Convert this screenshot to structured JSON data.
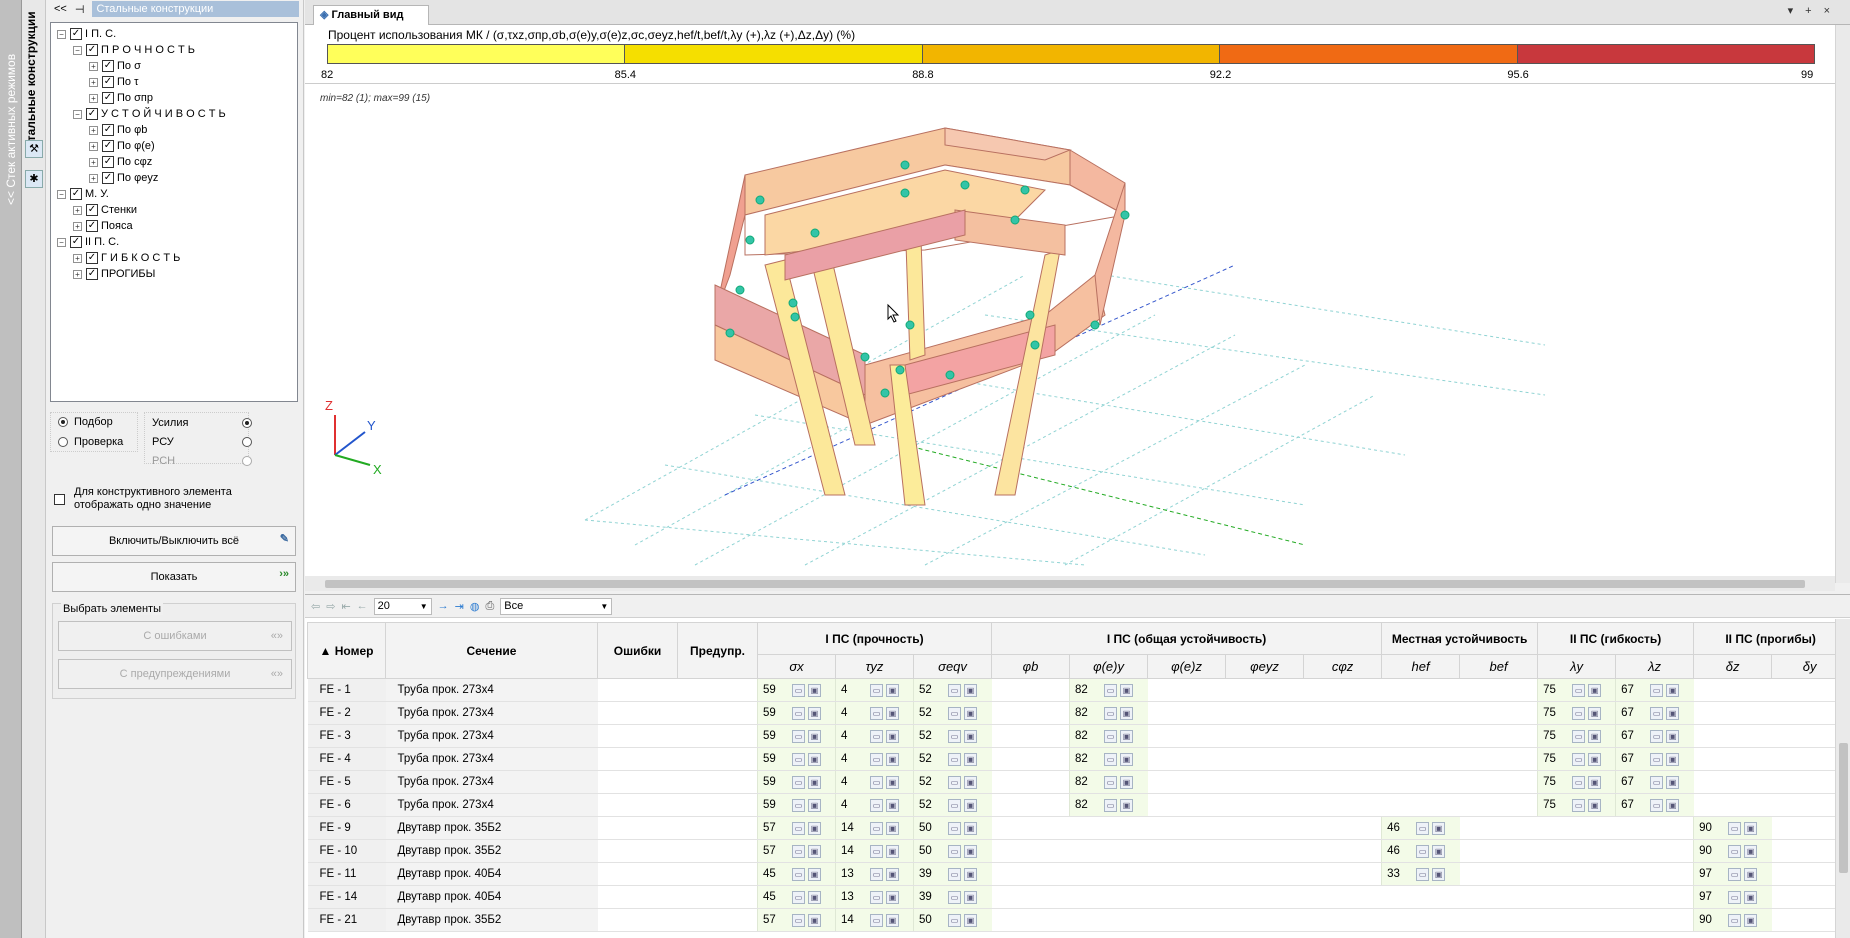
{
  "side": {
    "stack_label": "<< Стек активных режимов",
    "mode_label": "Стальные конструкции"
  },
  "left": {
    "title": "Стальные конструкции",
    "tree": [
      {
        "text": "I  П. С.",
        "level": 0,
        "toggle": "−"
      },
      {
        "text": "П Р О Ч Н О С Т Ь",
        "level": 1,
        "toggle": "−"
      },
      {
        "text": "По σ",
        "level": 2,
        "toggle": "+"
      },
      {
        "text": "По τ",
        "level": 2,
        "toggle": "+"
      },
      {
        "text": "По σпр",
        "level": 2,
        "toggle": "+"
      },
      {
        "text": "У С Т О Й Ч И В О С Т Ь",
        "level": 1,
        "toggle": "−"
      },
      {
        "text": "По φb",
        "level": 2,
        "toggle": "+"
      },
      {
        "text": "По φ(e)",
        "level": 2,
        "toggle": "+"
      },
      {
        "text": "По cφz",
        "level": 2,
        "toggle": "+"
      },
      {
        "text": "По φeyz",
        "level": 2,
        "toggle": "+"
      },
      {
        "text": "М. У.",
        "level": 0,
        "toggle": "−"
      },
      {
        "text": "Стенки",
        "level": 1,
        "toggle": "+"
      },
      {
        "text": "Пояса",
        "level": 1,
        "toggle": "+"
      },
      {
        "text": "II  П. С.",
        "level": 0,
        "toggle": "−"
      },
      {
        "text": "Г И Б К О С Т Ь",
        "level": 1,
        "toggle": "+"
      },
      {
        "text": "ПРОГИБЫ",
        "level": 1,
        "toggle": "+"
      }
    ],
    "mode_podbor": "Подбор",
    "mode_proverka": "Проверка",
    "forces": "Усилия",
    "rsu": "РСУ",
    "rsn": "РСН",
    "one_value": "Для конструктивного элемента отображать одно значение",
    "toggle_all": "Включить/Выключить всё",
    "show": "Показать",
    "select_group": "Выбрать элементы",
    "with_errors": "С ошибками",
    "with_warnings": "С предупреждениями"
  },
  "main": {
    "tab": "Главный вид",
    "legend_title": "Процент использования МК / (σ,τxz,σпр,σb,σ(e)y,σ(e)z,σc,σeyz,hef/t,bef/t,λy (+),λz (+),Δz,Δy) (%)",
    "legend_values": [
      "82",
      "85.4",
      "88.8",
      "92.2",
      "95.6",
      "99"
    ],
    "legend_colors": [
      "#ffff5a",
      "#f5df00",
      "#f2b500",
      "#f06a14",
      "#c8383d"
    ],
    "minmax": "min=82 (1); max=99 (15)",
    "axes": {
      "z": "Z",
      "y": "Y",
      "x": "X"
    }
  },
  "grid": {
    "page_size": "20",
    "filter": "Все",
    "headers": {
      "number": "Номер",
      "section": "Сечение",
      "errors": "Ошибки",
      "warnings": "Предупр.",
      "g1": "I ПС (прочность)",
      "g2": "I ПС (общая устойчивость)",
      "g3": "Местная устойчивость",
      "g4": "II ПС (гибкость)",
      "g5": "II ПС (прогибы)"
    },
    "subheaders": [
      "σx",
      "τyz",
      "σeqv",
      "φb",
      "φ(e)y",
      "φ(e)z",
      "φeyz",
      "cφz",
      "hef",
      "bef",
      "λy",
      "λz",
      "δz",
      "δy"
    ],
    "rows": [
      {
        "id": "FE - 1",
        "sec": "Труба прок. 273x4",
        "c": [
          "59",
          "4",
          "52",
          "",
          "82",
          "",
          "",
          "",
          "",
          "",
          "75",
          "67",
          "",
          ""
        ]
      },
      {
        "id": "FE - 2",
        "sec": "Труба прок. 273x4",
        "c": [
          "59",
          "4",
          "52",
          "",
          "82",
          "",
          "",
          "",
          "",
          "",
          "75",
          "67",
          "",
          ""
        ]
      },
      {
        "id": "FE - 3",
        "sec": "Труба прок. 273x4",
        "c": [
          "59",
          "4",
          "52",
          "",
          "82",
          "",
          "",
          "",
          "",
          "",
          "75",
          "67",
          "",
          ""
        ]
      },
      {
        "id": "FE - 4",
        "sec": "Труба прок. 273x4",
        "c": [
          "59",
          "4",
          "52",
          "",
          "82",
          "",
          "",
          "",
          "",
          "",
          "75",
          "67",
          "",
          ""
        ]
      },
      {
        "id": "FE - 5",
        "sec": "Труба прок. 273x4",
        "c": [
          "59",
          "4",
          "52",
          "",
          "82",
          "",
          "",
          "",
          "",
          "",
          "75",
          "67",
          "",
          ""
        ]
      },
      {
        "id": "FE - 6",
        "sec": "Труба прок. 273x4",
        "c": [
          "59",
          "4",
          "52",
          "",
          "82",
          "",
          "",
          "",
          "",
          "",
          "75",
          "67",
          "",
          ""
        ]
      },
      {
        "id": "FE - 9",
        "sec": "Двутавр прок. 35Б2",
        "c": [
          "57",
          "14",
          "50",
          "",
          "",
          "",
          "",
          "",
          "46",
          "",
          "",
          "",
          "90",
          ""
        ]
      },
      {
        "id": "FE - 10",
        "sec": "Двутавр прок. 35Б2",
        "c": [
          "57",
          "14",
          "50",
          "",
          "",
          "",
          "",
          "",
          "46",
          "",
          "",
          "",
          "90",
          ""
        ]
      },
      {
        "id": "FE - 11",
        "sec": "Двутавр прок. 40Б4",
        "c": [
          "45",
          "13",
          "39",
          "",
          "",
          "",
          "",
          "",
          "33",
          "",
          "",
          "",
          "97",
          ""
        ]
      },
      {
        "id": "FE - 14",
        "sec": "Двутавр прок. 40Б4",
        "c": [
          "45",
          "13",
          "39",
          "",
          "",
          "",
          "",
          "",
          "",
          "",
          "",
          "",
          "97",
          ""
        ]
      },
      {
        "id": "FE - 21",
        "sec": "Двутавр прок. 35Б2",
        "c": [
          "57",
          "14",
          "50",
          "",
          "",
          "",
          "",
          "",
          "",
          "",
          "",
          "",
          "90",
          ""
        ]
      }
    ]
  }
}
